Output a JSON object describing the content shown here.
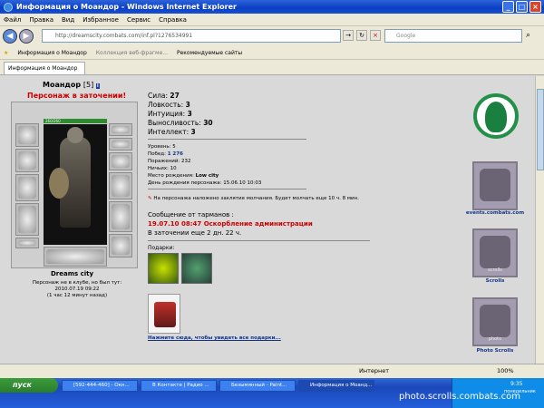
{
  "window": {
    "title": "Информация о Моандор - Windows Internet Explorer",
    "min": "_",
    "max": "□",
    "close": "×"
  },
  "menu": [
    "Файл",
    "Правка",
    "Вид",
    "Избранное",
    "Сервис",
    "Справка"
  ],
  "address": {
    "url": "http://dreamscity.combats.com/inf.pl?1276534991"
  },
  "search": {
    "placeholder": "Google"
  },
  "favorites": {
    "items": [
      "Информация о Моандор",
      "Коллекция веб-фрагме...",
      "Рекомендуемые сайты"
    ]
  },
  "tab": {
    "label": "Информация о Моандор"
  },
  "character": {
    "name": "Моандор",
    "level": "[5]",
    "badge": "i",
    "status": "Персонаж в заточении!",
    "hp": "260/260"
  },
  "stats": {
    "strength_label": "Сила:",
    "strength": "27",
    "agility_label": "Ловкость:",
    "agility": "3",
    "intuition_label": "Интуиция:",
    "intuition": "3",
    "endurance_label": "Выносливость:",
    "endurance": "30",
    "intellect_label": "Интеллект:",
    "intellect": "3"
  },
  "info": {
    "level": "Уровень: 5",
    "wins_label": "Побед:",
    "wins": "1 276",
    "losses": "Поражений: 232",
    "draws": "Ничьих: 10",
    "birthplace_label": "Место рождения:",
    "birthplace": "Low city",
    "birthday": "День рождения персонажа: 15.06.10 10:03"
  },
  "silence": "На персонажа наложено заклятие молчания. Будет молчать еще 10 ч. 8 мин.",
  "message": {
    "head": "Сообщение от тарманов :",
    "text": "19.07.10 08:47 Оскорбление администрации",
    "jail": "В заточении еще 2 дн. 22 ч."
  },
  "gifts": {
    "label": "Подарки:",
    "link": "Нажмите сюда, чтобы увидеть все подарки..."
  },
  "city": {
    "title": "Dreams city",
    "line1": "Персонаж не в клубе, но был тут:",
    "line2": "2010.07.19 09:22",
    "line3": "(1 час 12 минут назад)"
  },
  "right": {
    "events": "events.combats.com",
    "scrolls": "Scrolls",
    "photo": "Photo Scrolls",
    "scroll_badge": "scrolls",
    "photo_badge": "photo"
  },
  "statusbar": {
    "zone": "Интернет",
    "zoom": "100%"
  },
  "taskbar": {
    "start": "пуск",
    "tasks": [
      "[592-444-460] - Окн...",
      "В Контакте | Радио ...",
      "Безымянный - Paint...",
      "Информация о Моанд..."
    ],
    "time": "9:35",
    "day": "понедельник"
  },
  "watermark": "photo.scrolls.combats.com"
}
